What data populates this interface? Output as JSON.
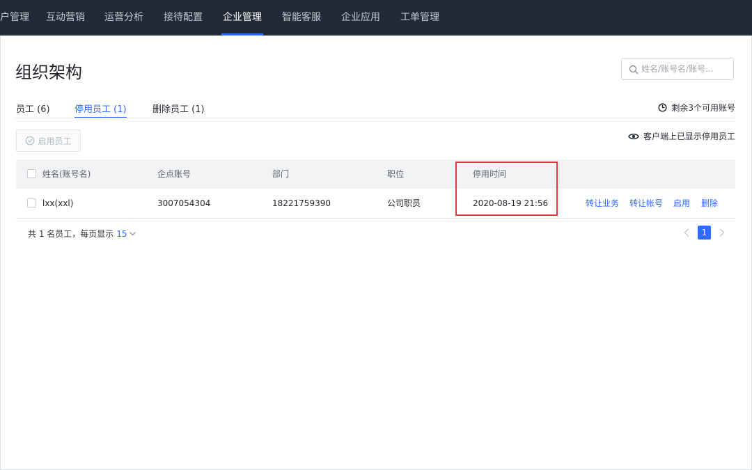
{
  "nav": {
    "items": [
      {
        "label": "户管理",
        "active": false
      },
      {
        "label": "互动营销",
        "active": false
      },
      {
        "label": "运营分析",
        "active": false
      },
      {
        "label": "接待配置",
        "active": false
      },
      {
        "label": "企业管理",
        "active": true
      },
      {
        "label": "智能客服",
        "active": false
      },
      {
        "label": "企业应用",
        "active": false
      },
      {
        "label": "工单管理",
        "active": false
      }
    ]
  },
  "page": {
    "title": "组织架构",
    "search_placeholder": "姓名/账号名/账号..."
  },
  "tabs": [
    {
      "label": "员工 (6)",
      "active": false
    },
    {
      "label": "停用员工 (1)",
      "active": true
    },
    {
      "label": "删除员工 (1)",
      "active": false
    }
  ],
  "account_info": "剩余3个可用账号",
  "toolbar": {
    "enable_label": "启用员工",
    "shown_info": "客户端上已显示停用员工"
  },
  "table": {
    "headers": [
      "姓名(账号名)",
      "企点账号",
      "部门",
      "职位",
      "停用时间"
    ],
    "rows": [
      {
        "name": "lxx(xxl)",
        "account": "3007054304",
        "department": "18221759390",
        "position": "公司职员",
        "disabled_time": "2020-08-19 21:56",
        "actions": [
          "转让业务",
          "转让帐号",
          "启用",
          "删除"
        ]
      }
    ]
  },
  "footer": {
    "summary": "共 1 名员工，每页显示",
    "page_size": "15",
    "current_page": "1"
  },
  "colors": {
    "nav_bg": "#232a37",
    "accent": "#2f6bff",
    "highlight": "#e03b3b"
  }
}
